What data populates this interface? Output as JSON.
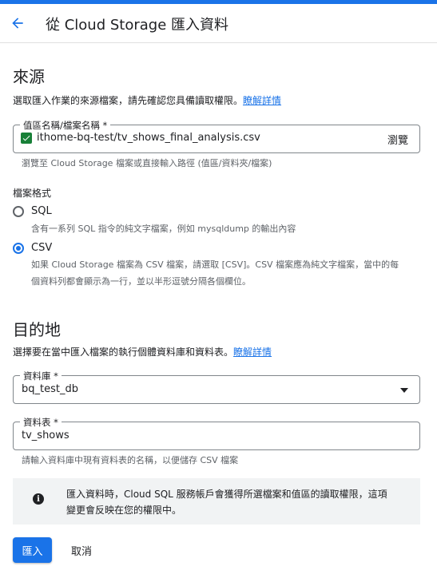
{
  "colors": {
    "accent": "#1a73e8",
    "checkbox": "#188038",
    "info_bg": "#f1f3f4"
  },
  "header": {
    "title": "從 Cloud Storage 匯入資料",
    "back_icon": "arrow-back-icon"
  },
  "source": {
    "heading": "來源",
    "description": "選取匯入作業的來源檔案，請先確認您具備讀取權限。",
    "learn_more": "瞭解詳情",
    "path_field": {
      "label": "值區名稱/檔案名稱 *",
      "value": "ithome-bq-test/tv_shows_final_analysis.csv",
      "browse_label": "瀏覽",
      "helper": "瀏覽至 Cloud Storage 檔案或直接輸入路徑 (值區/資料夾/檔案)"
    },
    "file_format": {
      "label": "檔案格式",
      "selected": "CSV",
      "options": [
        {
          "title": "SQL",
          "description": "含有一系列 SQL 指令的純文字檔案，例如 mysqldump 的輸出內容"
        },
        {
          "title": "CSV",
          "description_line1": "如果 Cloud Storage 檔案為 CSV 檔案，請選取 [CSV]。CSV 檔案應為純文字檔案，當中的每",
          "description_line2": "個資料列都會顯示為一行，並以半形逗號分隔各個欄位。"
        }
      ]
    }
  },
  "destination": {
    "heading": "目的地",
    "description": "選擇要在當中匯入檔案的執行個體資料庫和資料表。",
    "learn_more": "瞭解詳情",
    "database": {
      "label": "資料庫 *",
      "value": "bq_test_db"
    },
    "table": {
      "label": "資料表 *",
      "value": "tv_shows",
      "helper": "請輸入資料庫中現有資料表的名稱，以便儲存 CSV 檔案"
    }
  },
  "info_box": {
    "icon": "info-icon",
    "line1": "匯入資料時，Cloud SQL 服務帳戶會獲得所選檔案和值區的讀取權限，這項",
    "line2": "變更會反映在您的權限中。"
  },
  "actions": {
    "import_label": "匯入",
    "cancel_label": "取消"
  }
}
